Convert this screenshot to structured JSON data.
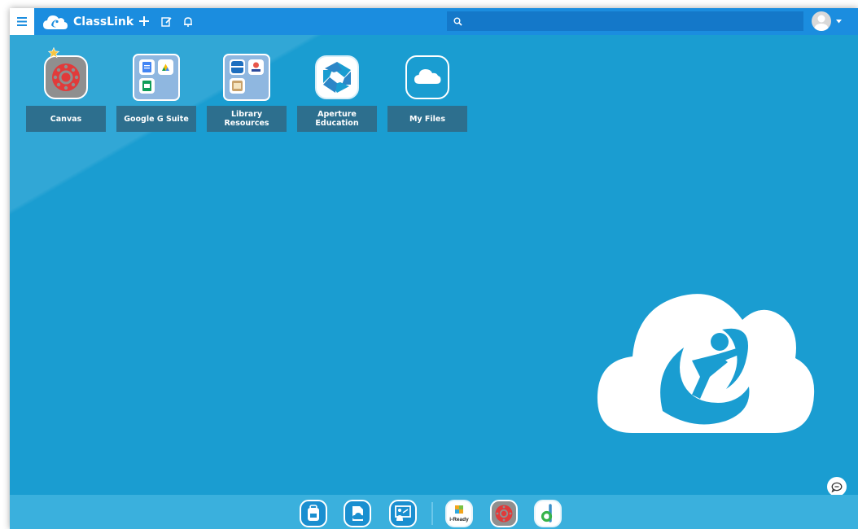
{
  "header": {
    "brand": "ClassLink",
    "search_placeholder": ""
  },
  "apps": [
    {
      "label": "Canvas",
      "icon": "canvas-icon",
      "favorite": true
    },
    {
      "label": "Google G Suite",
      "icon": "google-g-suite-folder-icon",
      "favorite": false
    },
    {
      "label": "Library Resources",
      "icon": "library-resources-folder-icon",
      "favorite": false
    },
    {
      "label": "Aperture Education",
      "icon": "aperture-education-icon",
      "favorite": false
    },
    {
      "label": "My Files",
      "icon": "my-files-cloud-icon",
      "favorite": false
    }
  ],
  "dock": {
    "items": [
      {
        "icon": "backpack-icon"
      },
      {
        "icon": "cloud-document-icon"
      },
      {
        "icon": "classroom-presenter-icon"
      },
      {
        "icon": "iready-icon",
        "label": "i-Ready"
      },
      {
        "icon": "canvas-icon"
      },
      {
        "icon": "desmos-d-icon"
      }
    ]
  },
  "colors": {
    "background": "#1a9dd1",
    "topbar": "#1b8ddf",
    "search": "#1478c9",
    "tile_label": "#2d6f8e",
    "dock": "#3ab0dd",
    "canvas_red": "#e13a3a"
  }
}
